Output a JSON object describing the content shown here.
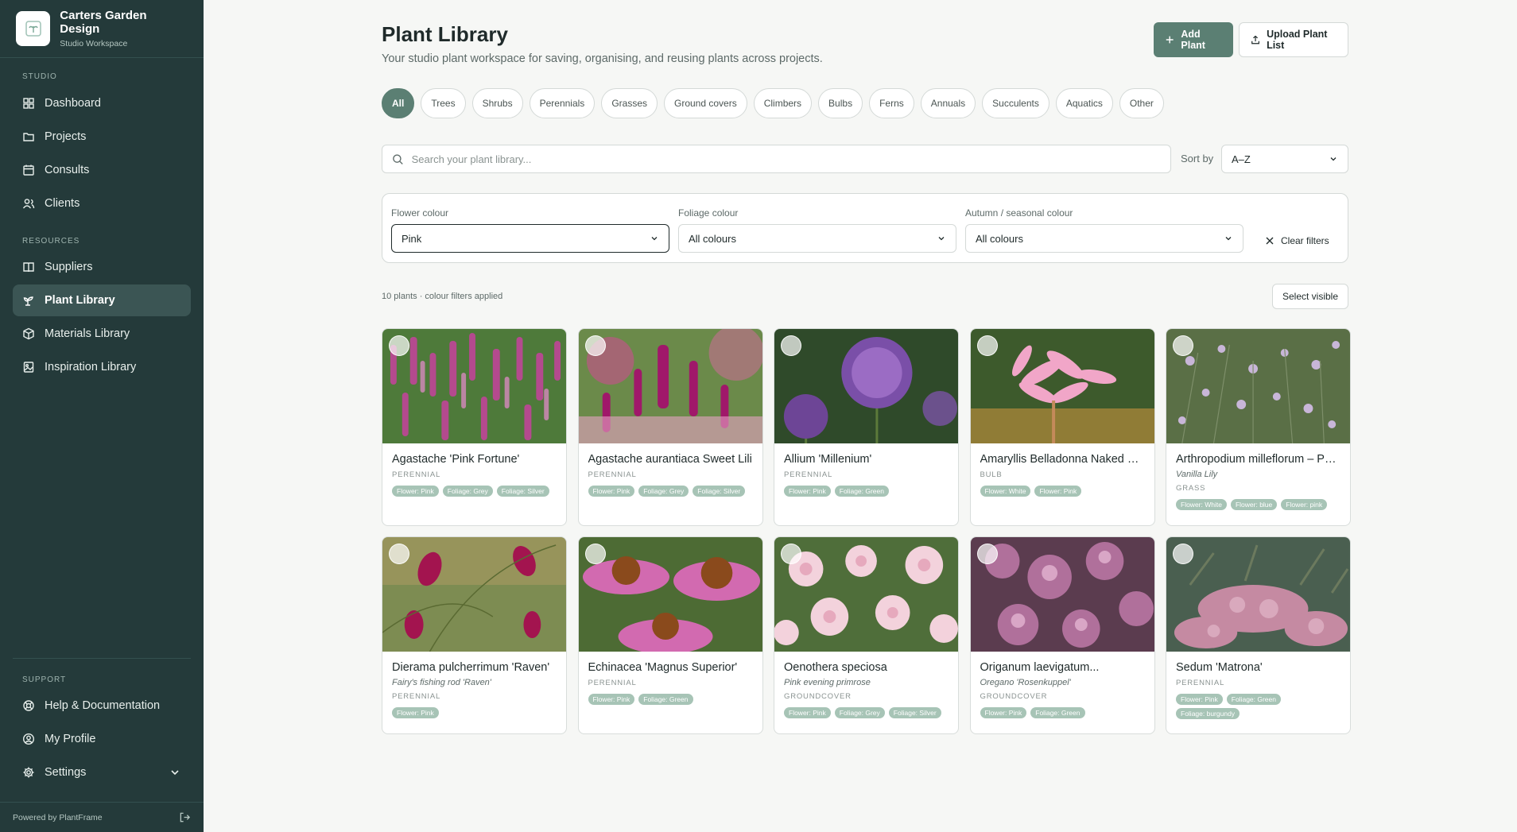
{
  "brand": {
    "title": "Carters Garden Design",
    "subtitle": "Studio Workspace"
  },
  "sidebar": {
    "studio_label": "STUDIO",
    "studio_items": [
      {
        "label": "Dashboard",
        "icon": "dashboard-icon"
      },
      {
        "label": "Projects",
        "icon": "folder-icon"
      },
      {
        "label": "Consults",
        "icon": "calendar-icon"
      },
      {
        "label": "Clients",
        "icon": "users-icon"
      }
    ],
    "resources_label": "RESOURCES",
    "resources_items": [
      {
        "label": "Suppliers",
        "icon": "book-icon"
      },
      {
        "label": "Plant Library",
        "icon": "sprout-icon",
        "active": true
      },
      {
        "label": "Materials Library",
        "icon": "package-icon"
      },
      {
        "label": "Inspiration Library",
        "icon": "image-icon"
      }
    ],
    "support_label": "SUPPORT",
    "support_items": [
      {
        "label": "Help & Documentation",
        "icon": "help-icon"
      },
      {
        "label": "My Profile",
        "icon": "profile-icon"
      },
      {
        "label": "Settings",
        "icon": "gear-icon"
      }
    ],
    "footer": "Powered by PlantFrame"
  },
  "header": {
    "title": "Plant Library",
    "subtitle": "Your studio plant workspace for saving, organising, and reusing plants across projects.",
    "add_label": "Add Plant",
    "upload_label": "Upload Plant List"
  },
  "categories": [
    "All",
    "Trees",
    "Shrubs",
    "Perennials",
    "Grasses",
    "Ground covers",
    "Climbers",
    "Bulbs",
    "Ferns",
    "Annuals",
    "Succulents",
    "Aquatics",
    "Other"
  ],
  "search": {
    "placeholder": "Search your plant library..."
  },
  "sort": {
    "label": "Sort by",
    "value": "A–Z"
  },
  "filters": {
    "flower_label": "Flower colour",
    "flower_value": "Pink",
    "foliage_label": "Foliage colour",
    "foliage_value": "All colours",
    "autumn_label": "Autumn / seasonal colour",
    "autumn_value": "All colours",
    "clear_label": "Clear filters"
  },
  "results": {
    "count_text": "10 plants · colour filters applied",
    "select_visible": "Select visible"
  },
  "plants": [
    {
      "name": "Agastache 'Pink Fortune'",
      "common": "",
      "type": "PERENNIAL",
      "tags": [
        "Flower: Pink",
        "Foliage: Grey",
        "Foliage: Silver"
      ]
    },
    {
      "name": "Agastache aurantiaca Sweet Lili",
      "common": "",
      "type": "PERENNIAL",
      "tags": [
        "Flower: Pink",
        "Foliage: Grey",
        "Foliage: Silver"
      ]
    },
    {
      "name": "Allium 'Millenium'",
      "common": "",
      "type": "PERENNIAL",
      "tags": [
        "Flower: Pink",
        "Foliage: Green"
      ]
    },
    {
      "name": "Amaryllis Belladonna Naked Lad...",
      "common": "",
      "type": "BULB",
      "tags": [
        "Flower: White",
        "Flower: Pink"
      ]
    },
    {
      "name": "Arthropodium milleflorum – Pal...",
      "common": "Vanilla Lily",
      "type": "GRASS",
      "tags": [
        "Flower: White",
        "Flower: blue",
        "Flower: pink"
      ]
    },
    {
      "name": "Dierama pulcherrimum 'Raven'",
      "common": "Fairy's fishing rod 'Raven'",
      "type": "PERENNIAL",
      "tags": [
        "Flower: Pink"
      ]
    },
    {
      "name": "Echinacea 'Magnus Superior'",
      "common": "",
      "type": "PERENNIAL",
      "tags": [
        "Flower: Pink",
        "Foliage: Green"
      ]
    },
    {
      "name": "Oenothera speciosa",
      "common": "Pink evening primrose",
      "type": "GROUNDCOVER",
      "tags": [
        "Flower: Pink",
        "Foliage: Grey",
        "Foliage: Silver"
      ]
    },
    {
      "name": "Origanum laevigatum...",
      "common": "Oregano 'Rosenkuppel'",
      "type": "GROUNDCOVER",
      "tags": [
        "Flower: Pink",
        "Foliage: Green"
      ]
    },
    {
      "name": "Sedum 'Matrona'",
      "common": "",
      "type": "PERENNIAL",
      "tags": [
        "Flower: Pink",
        "Foliage: Green",
        "Foliage: burgundy"
      ]
    }
  ],
  "colors": {
    "sidebar": "#243a3a",
    "accent": "#5b7f73",
    "tag": "#a7c4b6"
  }
}
